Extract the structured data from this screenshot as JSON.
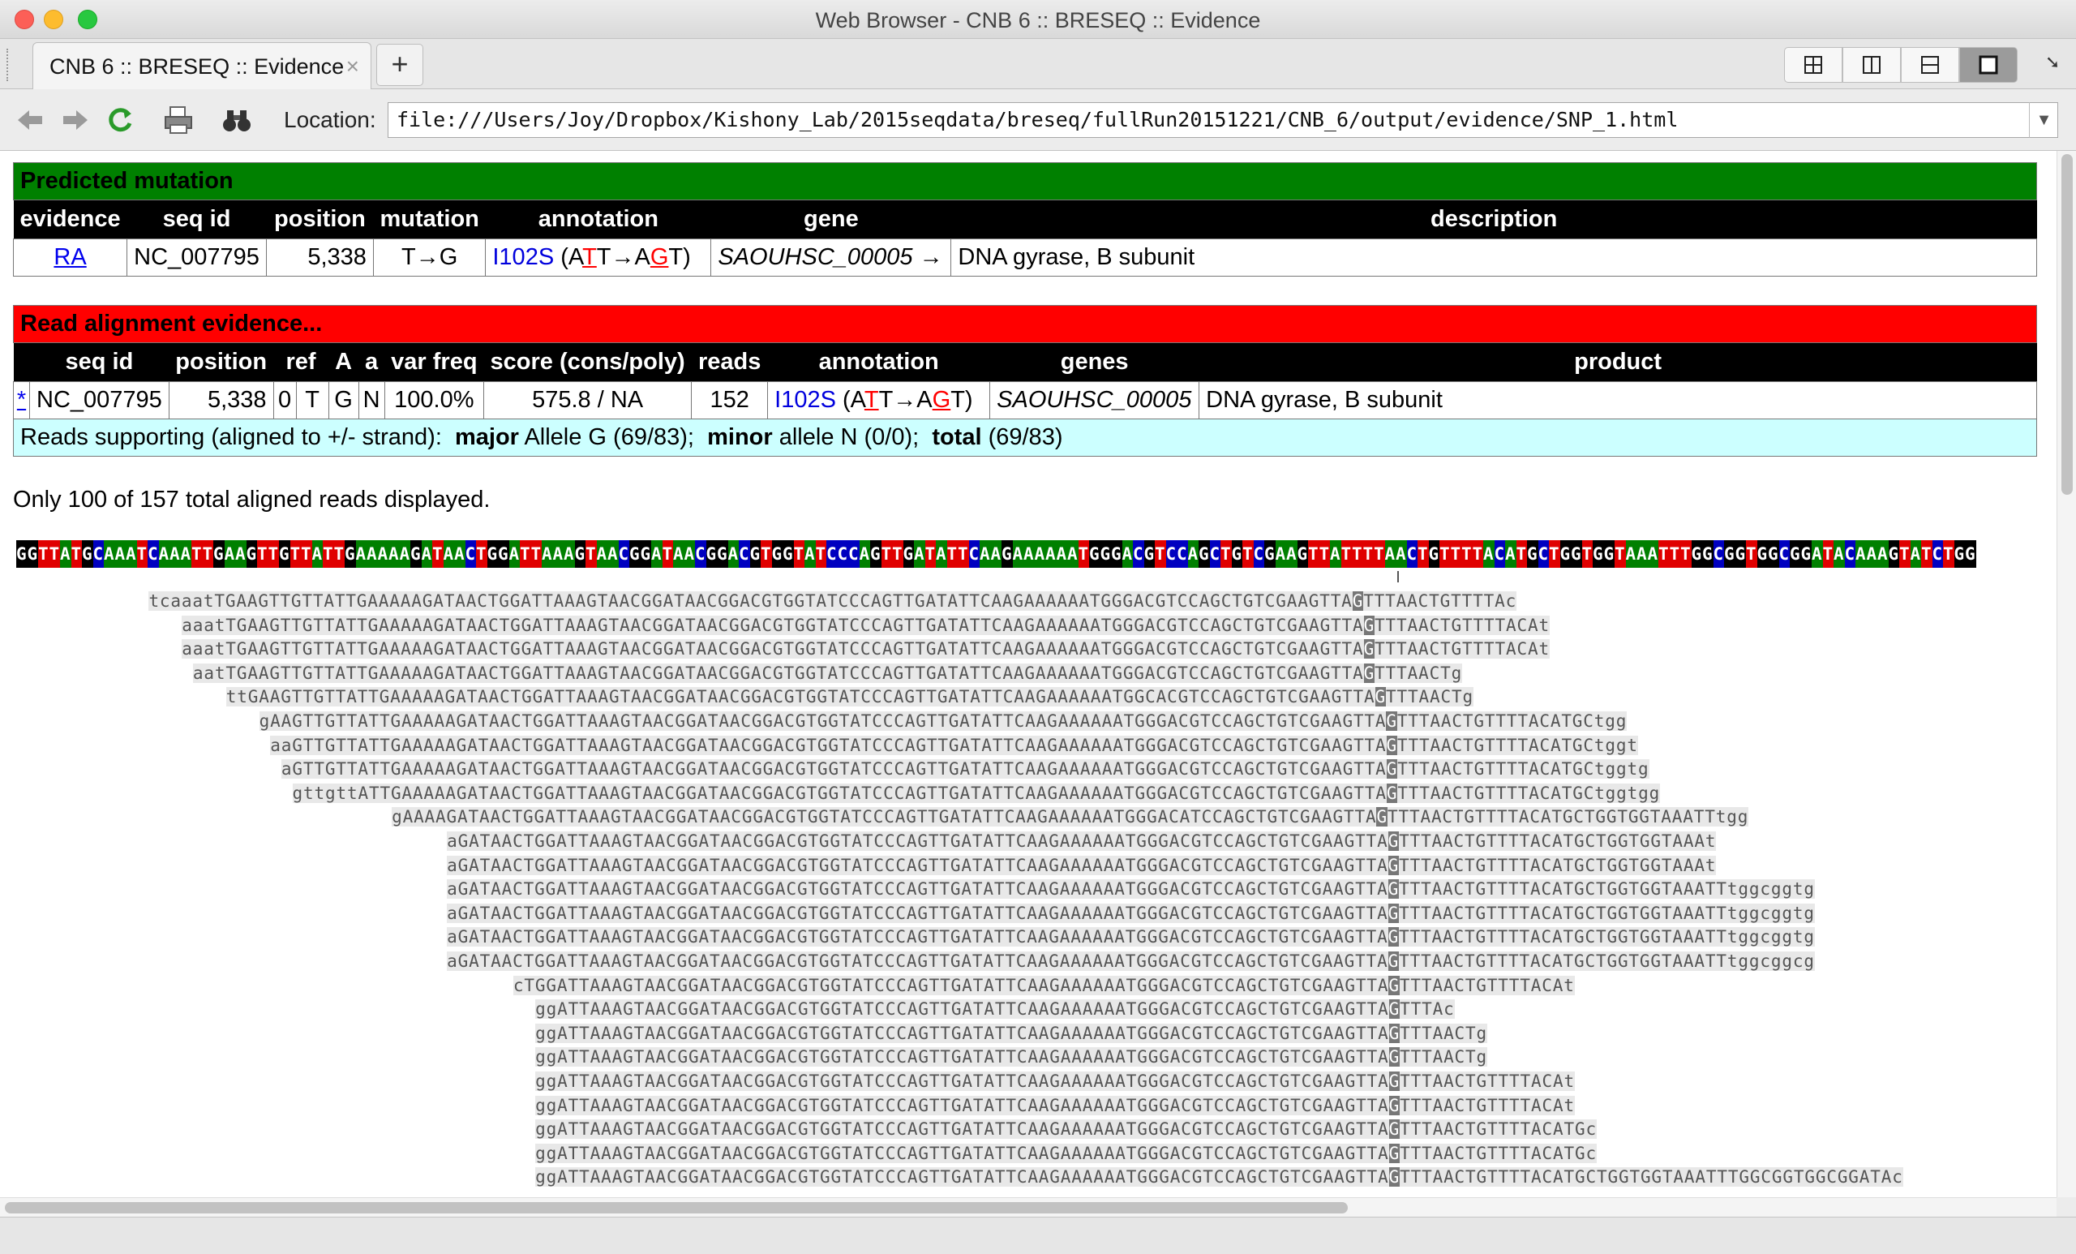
{
  "window": {
    "title": "Web Browser - CNB 6 :: BRESEQ :: Evidence"
  },
  "tabs": [
    {
      "label": "CNB 6 :: BRESEQ :: Evidence",
      "close": "×"
    }
  ],
  "tab_new_label": "+",
  "toolbar": {
    "location_label": "Location:",
    "location_value": "file:///Users/Joy/Dropbox/Kishony_Lab/2015seqdata/breseq/fullRun20151221/CNB_6/output/evidence/SNP_1.html"
  },
  "predicted": {
    "title": "Predicted mutation",
    "headers": [
      "evidence",
      "seq id",
      "position",
      "mutation",
      "annotation",
      "gene",
      "description"
    ],
    "row": {
      "evidence": "RA",
      "seq_id": "NC_007795",
      "position": "5,338",
      "mutation": "T→G",
      "anno_aa": "I102S",
      "anno_codon_pre": " (A",
      "anno_codon_mid1": "T",
      "anno_codon_arrow": "T→A",
      "anno_codon_mid2": "G",
      "anno_codon_post": "T)",
      "gene": "SAOUHSC_00005",
      "gene_arrow": "→",
      "description": "DNA gyrase, B subunit"
    }
  },
  "evidence": {
    "title": "Read alignment evidence...",
    "headers": [
      "",
      "seq id",
      "position",
      "ref",
      "A",
      "a",
      "var freq",
      "score (cons/poly)",
      "reads",
      "annotation",
      "genes",
      "product"
    ],
    "row": {
      "link": "*",
      "seq_id": "NC_007795",
      "position": "5,338",
      "zero": "0",
      "ref": "T",
      "A": "G",
      "a": "N",
      "var_freq": "100.0%",
      "score": "575.8 / NA",
      "reads": "152",
      "anno_aa": "I102S",
      "gene": "SAOUHSC_00005",
      "product": "DNA gyrase, B subunit"
    },
    "support": {
      "prefix": "Reads supporting (aligned to +/- strand):  ",
      "major_label": "major",
      "major_text": " Allele G (69/83);  ",
      "minor_label": "minor",
      "minor_text": " allele N (0/0);  ",
      "total_label": "total",
      "total_text": " (69/83)"
    }
  },
  "only_text": "Only 100 of 157 total aligned reads displayed.",
  "reference_sequence": "GGTTATGCAAATCAAATTGAAGTTGTTATTGAAAAAGATAACTGGATTAAAGTAACGGATAACGGACGTGGTATCCCAGTTGATATTCAAGAAAAAATGGGACGTCCAGCTGTCGAAGTTATTTTAACTGTTTTACATGCTGGTGGTAAATTTGGCGGTGGCGGATACAAAGTATCTGG",
  "base_colors": {
    "A": "#008000",
    "C": "#0000c0",
    "G": "#000000",
    "T": "#e00000"
  },
  "reads": [
    {
      "offset": 12,
      "pre": "tcaaatTGAAGTTGTTATTGAAAAAGATAACTGGATTAAAGTAACGGATAACGGACGTGGTATCCCAGTTGATATTCAAGAAAAAATGGGACGTCCAGCTGTCGAAGTTA",
      "mut": "G",
      "post": "TTTAACTGTTTTAc"
    },
    {
      "offset": 15,
      "pre": "aaatTGAAGTTGTTATTGAAAAAGATAACTGGATTAAAGTAACGGATAACGGACGTGGTATCCCAGTTGATATTCAAGAAAAAATGGGACGTCCAGCTGTCGAAGTTA",
      "mut": "G",
      "post": "TTTAACTGTTTTACAt"
    },
    {
      "offset": 15,
      "pre": "aaatTGAAGTTGTTATTGAAAAAGATAACTGGATTAAAGTAACGGATAACGGACGTGGTATCCCAGTTGATATTCAAGAAAAAATGGGACGTCCAGCTGTCGAAGTTA",
      "mut": "G",
      "post": "TTTAACTGTTTTACAt"
    },
    {
      "offset": 16,
      "pre": "aatTGAAGTTGTTATTGAAAAAGATAACTGGATTAAAGTAACGGATAACGGACGTGGTATCCCAGTTGATATTCAAGAAAAAATGGGACGTCCAGCTGTCGAAGTTA",
      "mut": "G",
      "post": "TTTAACTg"
    },
    {
      "offset": 19,
      "pre": "ttGAAGTTGTTATTGAAAAAGATAACTGGATTAAAGTAACGGATAACGGACGTGGTATCCCAGTTGATATTCAAGAAAAAATGGCACGTCCAGCTGTCGAAGTTA",
      "mut": "G",
      "post": "TTTAACTg"
    },
    {
      "offset": 22,
      "pre": "gAAGTTGTTATTGAAAAAGATAACTGGATTAAAGTAACGGATAACGGACGTGGTATCCCAGTTGATATTCAAGAAAAAATGGGACGTCCAGCTGTCGAAGTTA",
      "mut": "G",
      "post": "TTTAACTGTTTTACATGCtgg"
    },
    {
      "offset": 23,
      "pre": "aaGTTGTTATTGAAAAAGATAACTGGATTAAAGTAACGGATAACGGACGTGGTATCCCAGTTGATATTCAAGAAAAAATGGGACGTCCAGCTGTCGAAGTTA",
      "mut": "G",
      "post": "TTTAACTGTTTTACATGCtggt"
    },
    {
      "offset": 24,
      "pre": "aGTTGTTATTGAAAAAGATAACTGGATTAAAGTAACGGATAACGGACGTGGTATCCCAGTTGATATTCAAGAAAAAATGGGACGTCCAGCTGTCGAAGTTA",
      "mut": "G",
      "post": "TTTAACTGTTTTACATGCtggtg"
    },
    {
      "offset": 25,
      "pre": "gttgttATTGAAAAAGATAACTGGATTAAAGTAACGGATAACGGACGTGGTATCCCAGTTGATATTCAAGAAAAAATGGGACGTCCAGCTGTCGAAGTTA",
      "mut": "G",
      "post": "TTTAACTGTTTTACATGCtggtgg"
    },
    {
      "offset": 34,
      "pre": "gAAAAGATAACTGGATTAAAGTAACGGATAACGGACGTGGTATCCCAGTTGATATTCAAGAAAAAATGGGACATCCAGCTGTCGAAGTTA",
      "mut": "G",
      "post": "TTTAACTGTTTTACATGCTGGTGGTAAATTtgg"
    },
    {
      "offset": 39,
      "pre": "aGATAACTGGATTAAAGTAACGGATAACGGACGTGGTATCCCAGTTGATATTCAAGAAAAAATGGGACGTCCAGCTGTCGAAGTTA",
      "mut": "G",
      "post": "TTTAACTGTTTTACATGCTGGTGGTAAAt"
    },
    {
      "offset": 39,
      "pre": "aGATAACTGGATTAAAGTAACGGATAACGGACGTGGTATCCCAGTTGATATTCAAGAAAAAATGGGACGTCCAGCTGTCGAAGTTA",
      "mut": "G",
      "post": "TTTAACTGTTTTACATGCTGGTGGTAAAt"
    },
    {
      "offset": 39,
      "pre": "aGATAACTGGATTAAAGTAACGGATAACGGACGTGGTATCCCAGTTGATATTCAAGAAAAAATGGGACGTCCAGCTGTCGAAGTTA",
      "mut": "G",
      "post": "TTTAACTGTTTTACATGCTGGTGGTAAATTtggcggtg"
    },
    {
      "offset": 39,
      "pre": "aGATAACTGGATTAAAGTAACGGATAACGGACGTGGTATCCCAGTTGATATTCAAGAAAAAATGGGACGTCCAGCTGTCGAAGTTA",
      "mut": "G",
      "post": "TTTAACTGTTTTACATGCTGGTGGTAAATTtggcggtg"
    },
    {
      "offset": 39,
      "pre": "aGATAACTGGATTAAAGTAACGGATAACGGACGTGGTATCCCAGTTGATATTCAAGAAAAAATGGGACGTCCAGCTGTCGAAGTTA",
      "mut": "G",
      "post": "TTTAACTGTTTTACATGCTGGTGGTAAATTtggcggtg"
    },
    {
      "offset": 39,
      "pre": "aGATAACTGGATTAAAGTAACGGATAACGGACGTGGTATCCCAGTTGATATTCAAGAAAAAATGGGACGTCCAGCTGTCGAAGTTA",
      "mut": "G",
      "post": "TTTAACTGTTTTACATGCTGGTGGTAAATTtggcggcg"
    },
    {
      "offset": 45,
      "pre": "cTGGATTAAAGTAACGGATAACGGACGTGGTATCCCAGTTGATATTCAAGAAAAAATGGGACGTCCAGCTGTCGAAGTTA",
      "mut": "G",
      "post": "TTTAACTGTTTTACAt"
    },
    {
      "offset": 47,
      "pre": "ggATTAAAGTAACGGATAACGGACGTGGTATCCCAGTTGATATTCAAGAAAAAATGGGACGTCCAGCTGTCGAAGTTA",
      "mut": "G",
      "post": "TTTAc"
    },
    {
      "offset": 47,
      "pre": "ggATTAAAGTAACGGATAACGGACGTGGTATCCCAGTTGATATTCAAGAAAAAATGGGACGTCCAGCTGTCGAAGTTA",
      "mut": "G",
      "post": "TTTAACTg"
    },
    {
      "offset": 47,
      "pre": "ggATTAAAGTAACGGATAACGGACGTGGTATCCCAGTTGATATTCAAGAAAAAATGGGACGTCCAGCTGTCGAAGTTA",
      "mut": "G",
      "post": "TTTAACTg"
    },
    {
      "offset": 47,
      "pre": "ggATTAAAGTAACGGATAACGGACGTGGTATCCCAGTTGATATTCAAGAAAAAATGGGACGTCCAGCTGTCGAAGTTA",
      "mut": "G",
      "post": "TTTAACTGTTTTACAt"
    },
    {
      "offset": 47,
      "pre": "ggATTAAAGTAACGGATAACGGACGTGGTATCCCAGTTGATATTCAAGAAAAAATGGGACGTCCAGCTGTCGAAGTTA",
      "mut": "G",
      "post": "TTTAACTGTTTTACAt"
    },
    {
      "offset": 47,
      "pre": "ggATTAAAGTAACGGATAACGGACGTGGTATCCCAGTTGATATTCAAGAAAAAATGGGACGTCCAGCTGTCGAAGTTA",
      "mut": "G",
      "post": "TTTAACTGTTTTACATGc"
    },
    {
      "offset": 47,
      "pre": "ggATTAAAGTAACGGATAACGGACGTGGTATCCCAGTTGATATTCAAGAAAAAATGGGACGTCCAGCTGTCGAAGTTA",
      "mut": "G",
      "post": "TTTAACTGTTTTACATGc"
    },
    {
      "offset": 47,
      "pre": "ggATTAAAGTAACGGATAACGGACGTGGTATCCCAGTTGATATTCAAGAAAAAATGGGACGTCCAGCTGTCGAAGTTA",
      "mut": "G",
      "post": "TTTAACTGTTTTACATGCTGGTGGTAAATTTGGCGGTGGCGGATAc"
    }
  ],
  "colors": {
    "green_header": "#008000",
    "red_header": "#ff0000",
    "support_row": "#ccffff",
    "link_blue": "#0000ee"
  },
  "icons": [
    "back-arrow-icon",
    "forward-arrow-icon",
    "reload-icon",
    "print-icon",
    "find-binoculars-icon"
  ]
}
